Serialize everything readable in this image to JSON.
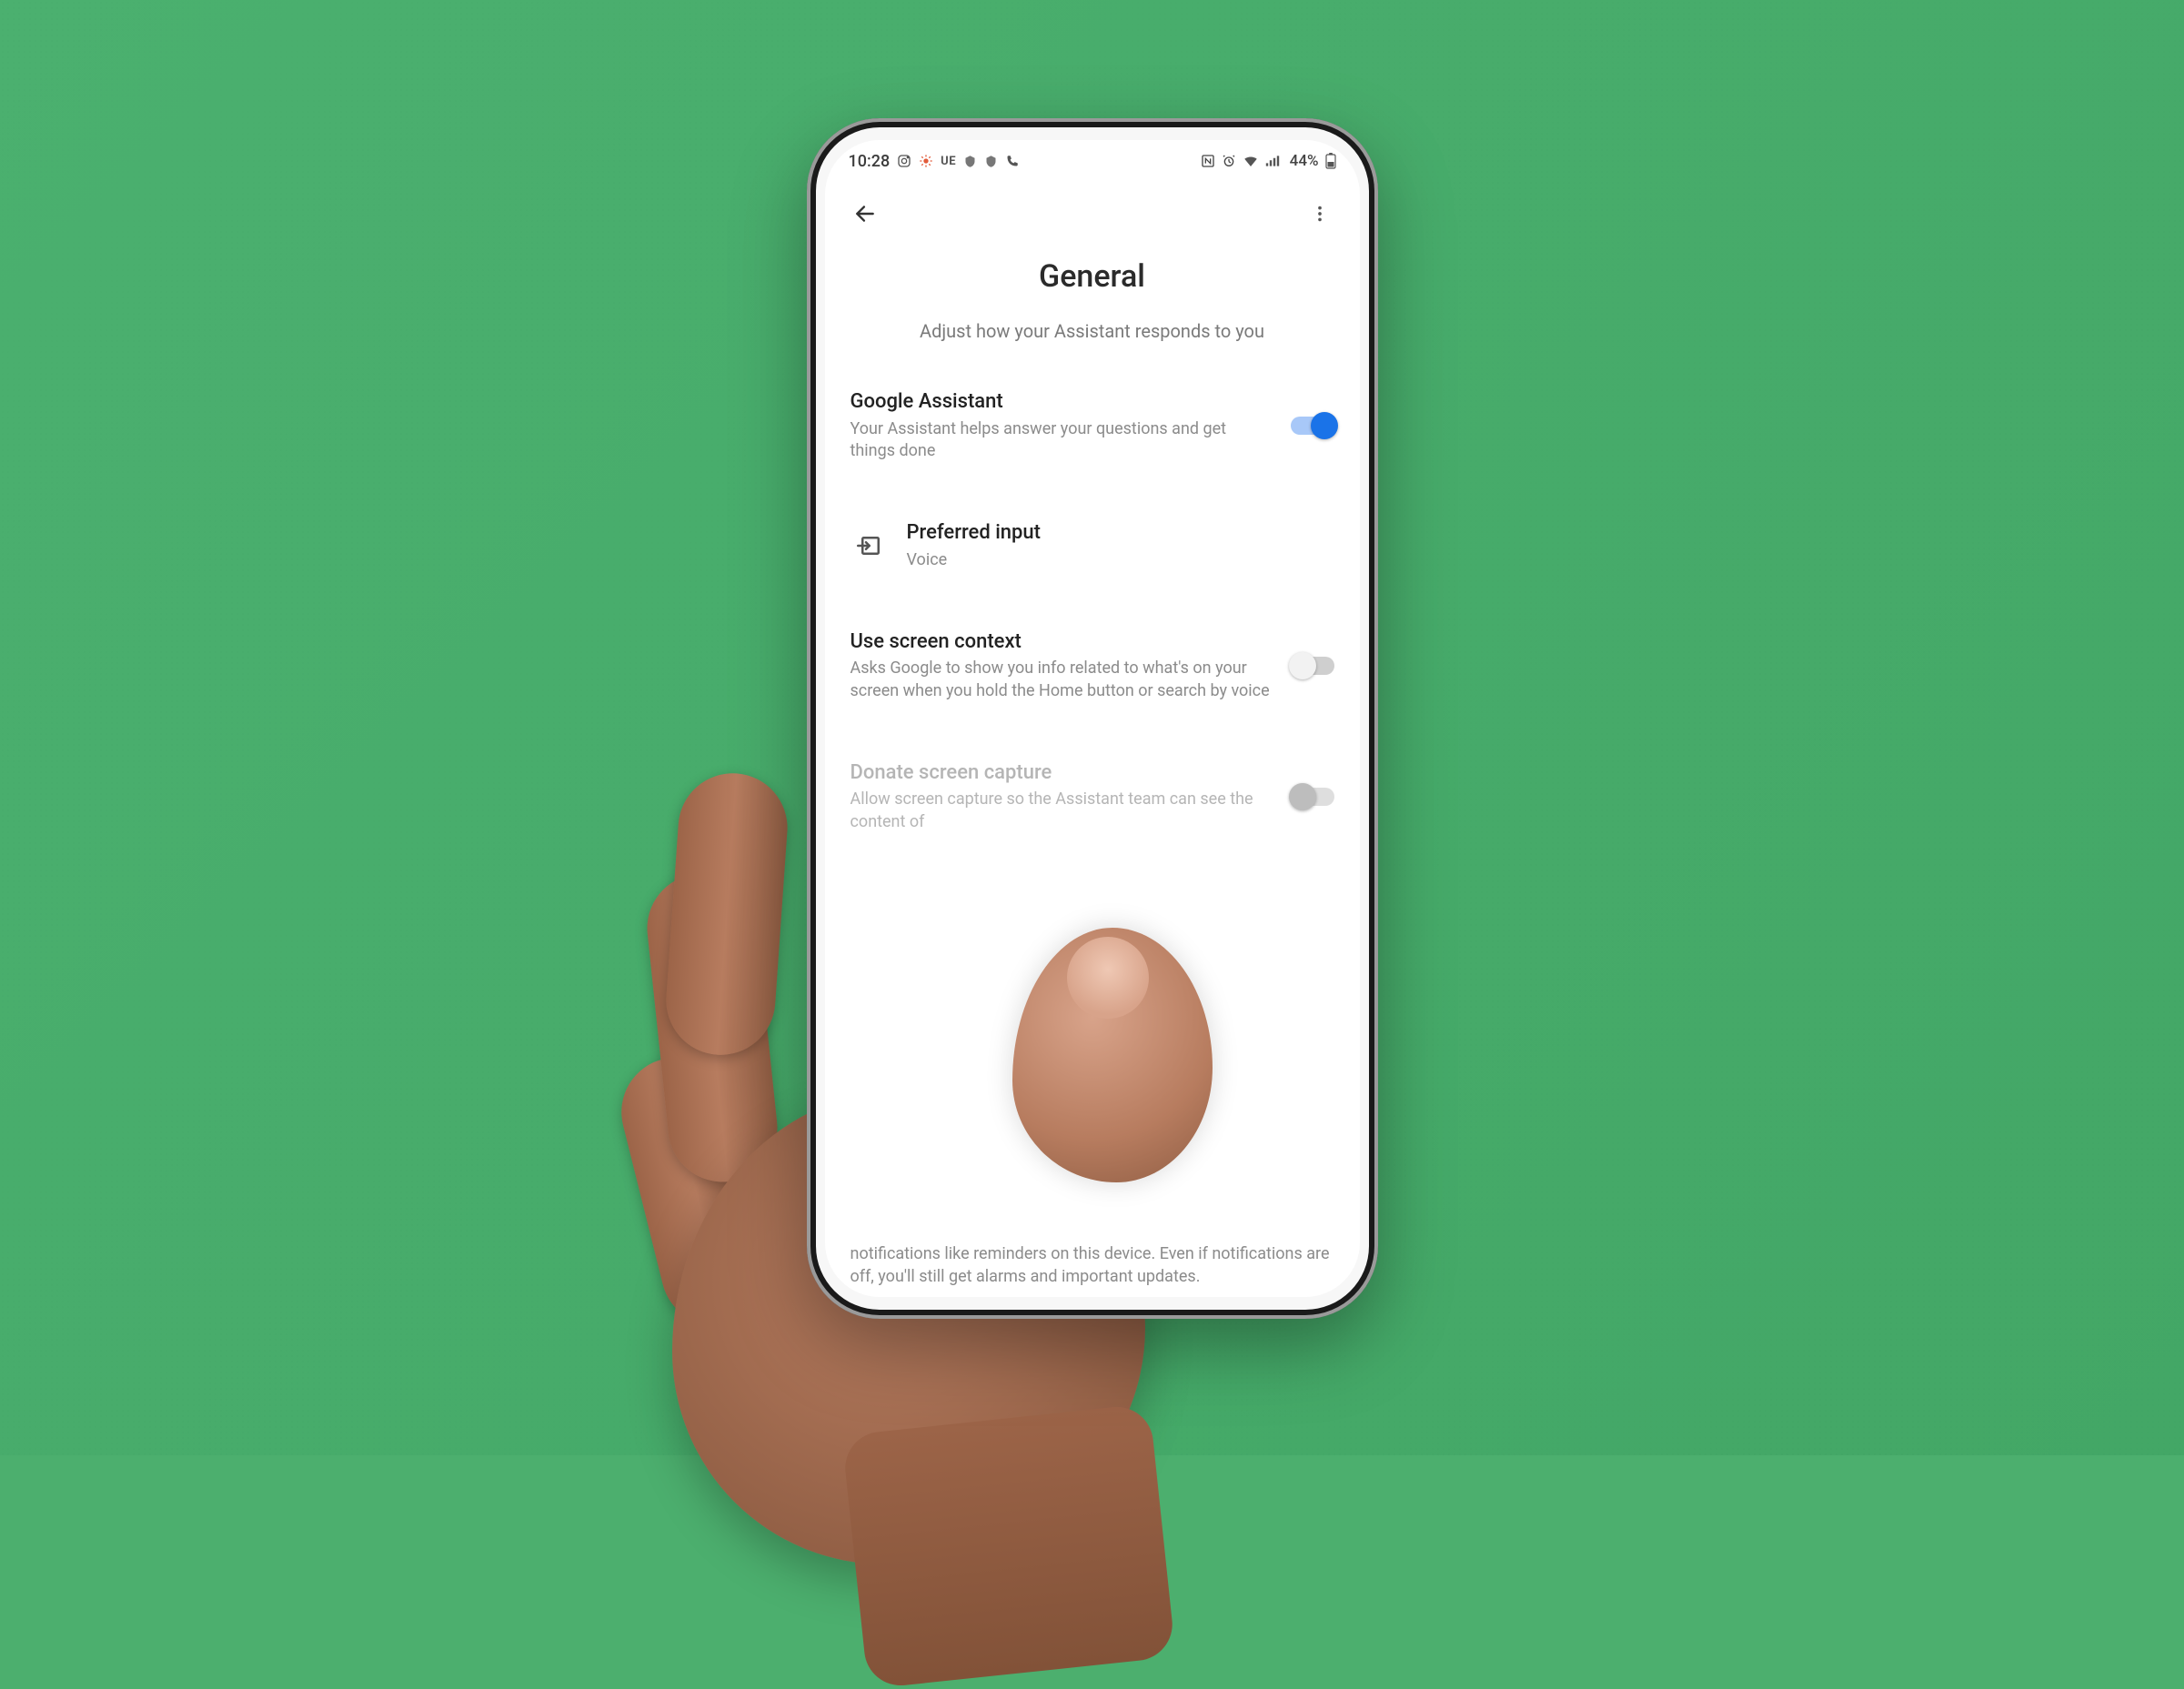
{
  "status": {
    "time": "10:28",
    "ue_badge": "UE",
    "battery_text": "44%"
  },
  "page": {
    "title": "General",
    "subtitle": "Adjust how your Assistant responds to you"
  },
  "rows": {
    "google_assistant": {
      "title": "Google Assistant",
      "desc": "Your Assistant helps answer your questions and get things done",
      "enabled": true
    },
    "preferred_input": {
      "title": "Preferred input",
      "value": "Voice"
    },
    "screen_context": {
      "title": "Use screen context",
      "desc": "Asks Google to show you info related to what's on your screen when you hold the Home button or search by voice",
      "enabled": false
    },
    "donate_capture": {
      "title": "Donate screen capture",
      "desc": "Allow screen capture so the Assistant team can see the content of",
      "enabled": false
    }
  },
  "bottom_note": "notifications like reminders on this device. Even if notifications are off, you'll still get alarms and important updates."
}
